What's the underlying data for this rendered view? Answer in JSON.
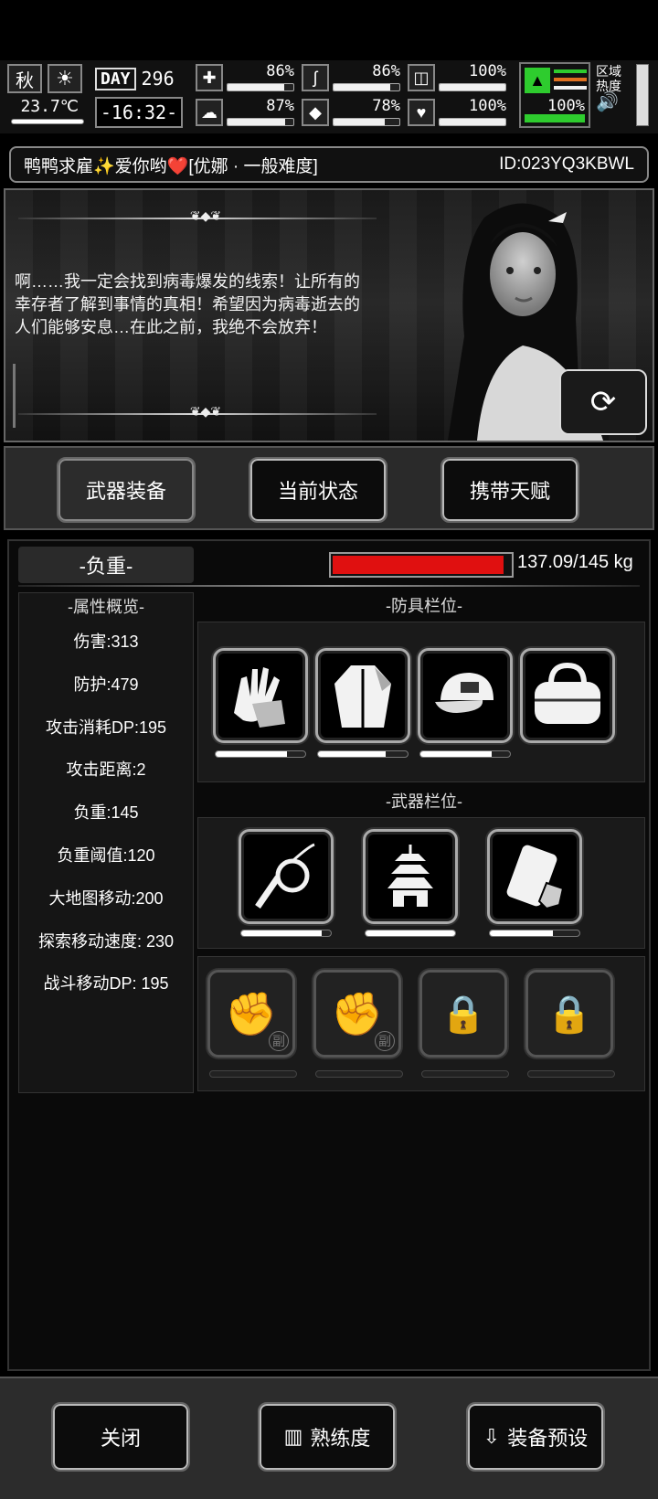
{
  "status": {
    "season": "秋",
    "temperature": "23.7℃",
    "day_label": "DAY",
    "day_number": "296",
    "time": "-16:32-",
    "stats": [
      {
        "icon": "medkit-icon",
        "glyph": "✚",
        "percent": "86%",
        "value": 0.86
      },
      {
        "icon": "stomach-icon",
        "glyph": "ʃ",
        "percent": "86%",
        "value": 0.86
      },
      {
        "icon": "pill-icon",
        "glyph": "◫",
        "percent": "100%",
        "value": 1.0
      },
      {
        "icon": "brain-icon",
        "glyph": "☁",
        "percent": "87%",
        "value": 0.87
      },
      {
        "icon": "water-drop-icon",
        "glyph": "💧",
        "percent": "78%",
        "value": 0.78
      },
      {
        "icon": "heart-icon",
        "glyph": "♥",
        "percent": "100%",
        "value": 1.0
      }
    ],
    "stamina_percent": "100%",
    "stamina_value": 1.0,
    "region_label": "区域热度",
    "stamina_colors": [
      "#2ecc2e",
      "#e07020",
      "#f0f0f0"
    ]
  },
  "player": {
    "name": "鸭鸭求雇✨爱你哟❤️[优娜 · 一般难度]",
    "id": "ID:023YQ3KBWL"
  },
  "dialog": {
    "text": "啊……我一定会找到病毒爆发的线索！让所有的幸存者了解到事情的真相！希望因为病毒逝去的人们能够安息…在此之前，我绝不会放弃！"
  },
  "tabs": [
    {
      "label": "武器装备",
      "active": true
    },
    {
      "label": "当前状态",
      "active": false
    },
    {
      "label": "携带天赋",
      "active": false
    }
  ],
  "load": {
    "title": "-负重-",
    "text": "137.09/145 kg",
    "value": 0.945,
    "bar_color": "#e01010"
  },
  "attributes": {
    "header": "-属性概览-",
    "rows": [
      "伤害:313",
      "防护:479",
      "攻击消耗DP:195",
      "攻击距离:2",
      "负重:145",
      "负重阈值:120",
      "大地图移动:200",
      "探索移动速度: 230",
      "战斗移动DP: 195"
    ]
  },
  "armor": {
    "header": "-防具栏位-",
    "slots": [
      {
        "icon": "gloves-icon",
        "glyph": "🧤",
        "durability": 0.8
      },
      {
        "icon": "cloak-icon",
        "glyph": "🧥",
        "durability": 0.75
      },
      {
        "icon": "cap-icon",
        "glyph": "🧢",
        "durability": 0.8
      },
      {
        "icon": "bag-icon",
        "glyph": "👜",
        "durability": null
      }
    ]
  },
  "weapons": {
    "header": "-武器栏位-",
    "slots": [
      {
        "icon": "whip-icon",
        "glyph": "➰",
        "durability": 0.9
      },
      {
        "icon": "pagoda-icon",
        "glyph": "🏯",
        "durability": 1.0
      },
      {
        "icon": "shield-pack-icon",
        "glyph": "🛡",
        "durability": 0.7
      }
    ]
  },
  "skills": {
    "slots": [
      {
        "icon": "fist-icon",
        "glyph": "✊",
        "badge": "副",
        "locked": false
      },
      {
        "icon": "fist-icon",
        "glyph": "✊",
        "badge": "副",
        "locked": false
      },
      {
        "icon": "fist-lock-icon",
        "glyph": "🔒",
        "badge": "",
        "locked": true
      },
      {
        "icon": "fist-lock-icon",
        "glyph": "🔒",
        "badge": "",
        "locked": true
      }
    ]
  },
  "bottom": {
    "close": "关闭",
    "proficiency": "熟练度",
    "preset": "装备预设"
  }
}
